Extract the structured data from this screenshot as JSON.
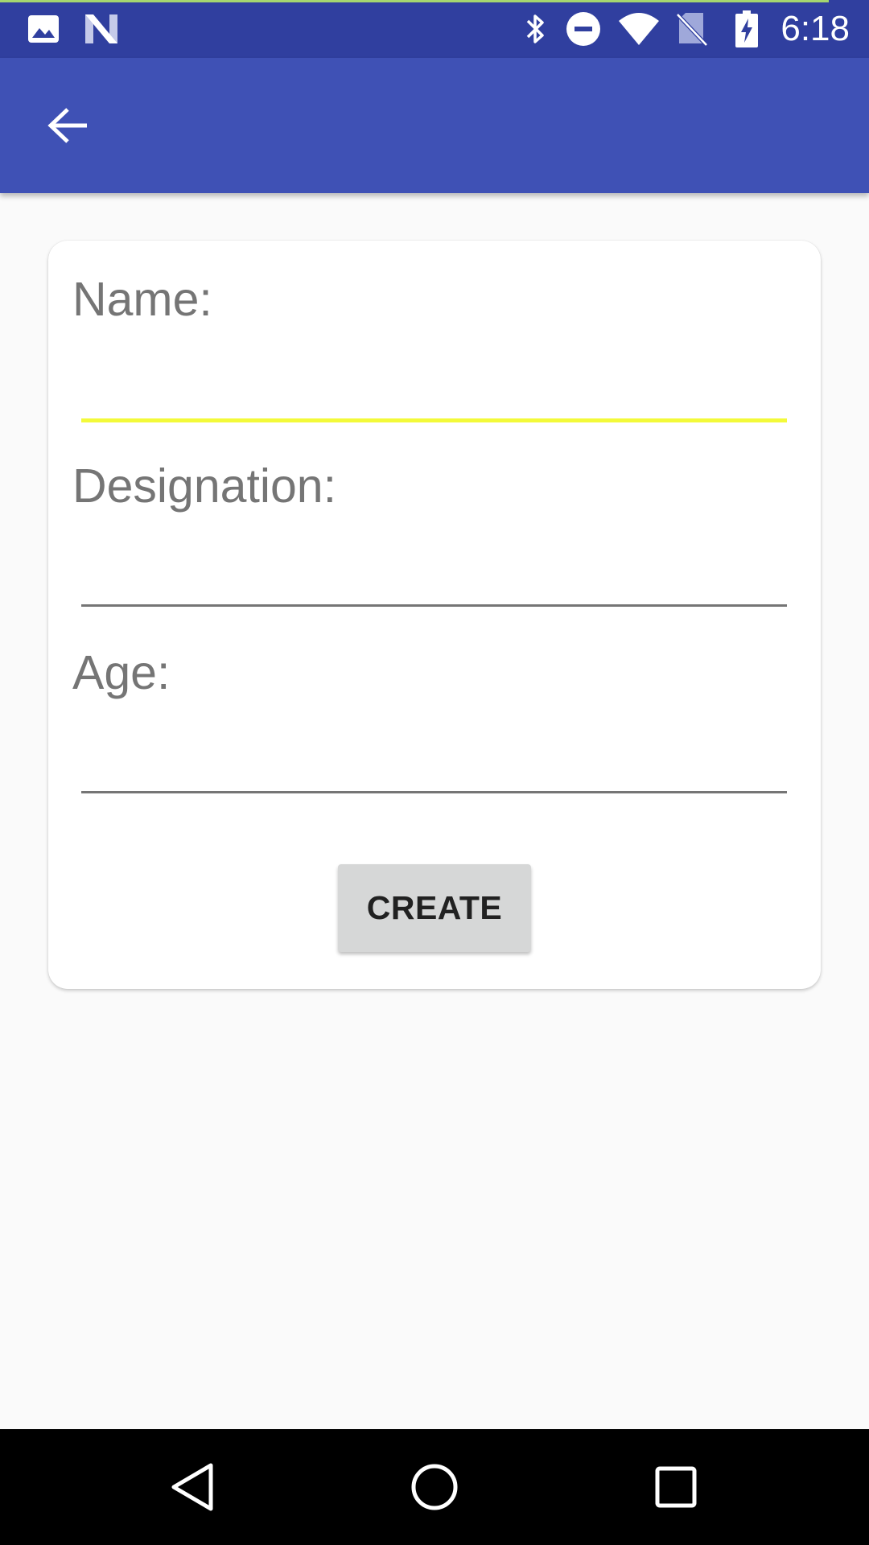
{
  "status_bar": {
    "time": "6:18",
    "icons": [
      "image-icon",
      "n-logo-icon",
      "bluetooth-icon",
      "do-not-disturb-icon",
      "wifi-icon",
      "no-sim-icon",
      "battery-charging-icon"
    ],
    "background_color": "#303f9f"
  },
  "app_bar": {
    "background_color": "#3f51b5",
    "back_icon": "arrow-back-icon"
  },
  "form": {
    "name_label": "Name:",
    "name_value": "",
    "designation_label": "Designation:",
    "designation_value": "",
    "age_label": "Age:",
    "age_value": "",
    "focused_field": "name",
    "focus_color": "#f3fa3a",
    "create_label": "CREATE"
  },
  "nav_bar": {
    "icons": [
      "back-triangle-icon",
      "home-circle-icon",
      "recents-square-icon"
    ]
  }
}
